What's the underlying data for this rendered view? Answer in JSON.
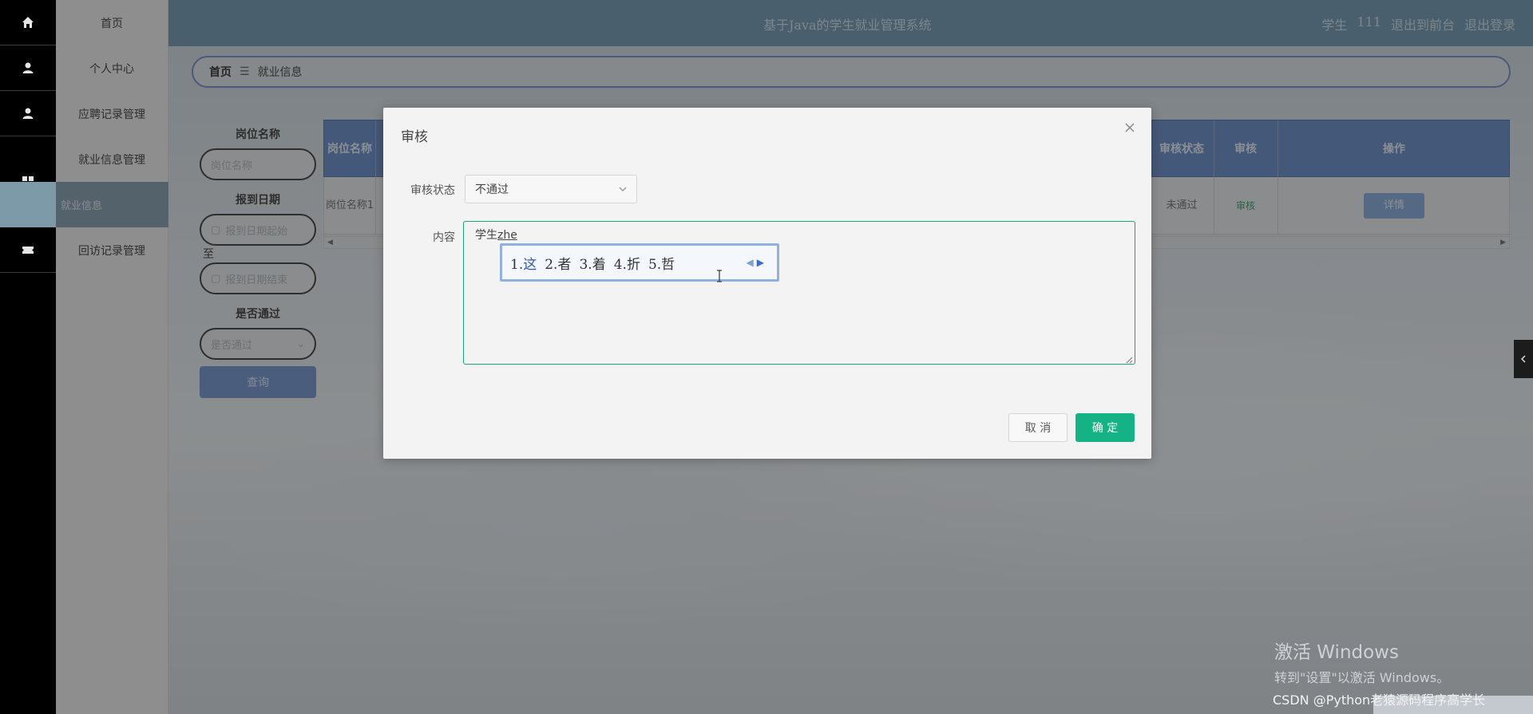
{
  "header": {
    "title": "基于Java的学生就业管理系统",
    "user_role": "学生",
    "username": "111",
    "back_to_front": "退出到前台",
    "logout": "退出登录"
  },
  "sidebar": {
    "icons": [
      "home-icon",
      "user-icon",
      "user-icon",
      "grid-icon",
      "ticket-icon"
    ],
    "items": [
      {
        "label": "首页"
      },
      {
        "label": "个人中心"
      },
      {
        "label": "应聘记录管理"
      },
      {
        "label": "就业信息管理"
      },
      {
        "label": "就业信息"
      },
      {
        "label": "回访记录管理"
      }
    ]
  },
  "breadcrumb": {
    "home": "首页",
    "separator": "☰",
    "current": "就业信息"
  },
  "search": {
    "position_label": "岗位名称",
    "position_placeholder": "岗位名称",
    "date_label": "报到日期",
    "date_start_placeholder": "报到日期起始",
    "date_to": "至",
    "date_end_placeholder": "报到日期结束",
    "passed_label": "是否通过",
    "passed_placeholder": "是否通过",
    "query_button": "查询"
  },
  "table": {
    "headers": {
      "position": "岗位名称",
      "audit_status": "审核状态",
      "audit": "审核",
      "actions": "操作"
    },
    "row": {
      "position": "岗位名称1",
      "audit_status": "未通过",
      "audit_link": "审核",
      "detail_button": "详情"
    }
  },
  "dialog": {
    "title": "审核",
    "status_label": "审核状态",
    "status_value": "不通过",
    "content_label": "内容",
    "content_prefix": "学生",
    "content_typing": "zhe",
    "ime_candidates": [
      {
        "index": "1.",
        "text": "这"
      },
      {
        "index": "2.",
        "text": "者"
      },
      {
        "index": "3.",
        "text": "着"
      },
      {
        "index": "4.",
        "text": "折"
      },
      {
        "index": "5.",
        "text": "哲"
      }
    ],
    "cancel_button": "取 消",
    "confirm_button": "确 定"
  },
  "watermarks": {
    "windows_title": "激活 Windows",
    "windows_sub": "转到\"设置\"以激活 Windows。",
    "csdn": "CSDN @Python老猿源码程序高学长"
  },
  "colors": {
    "header_bg": "#6a93ad",
    "table_head_bg": "#5f85c4",
    "confirm_green": "#13b386",
    "textarea_focus": "#18a383"
  }
}
